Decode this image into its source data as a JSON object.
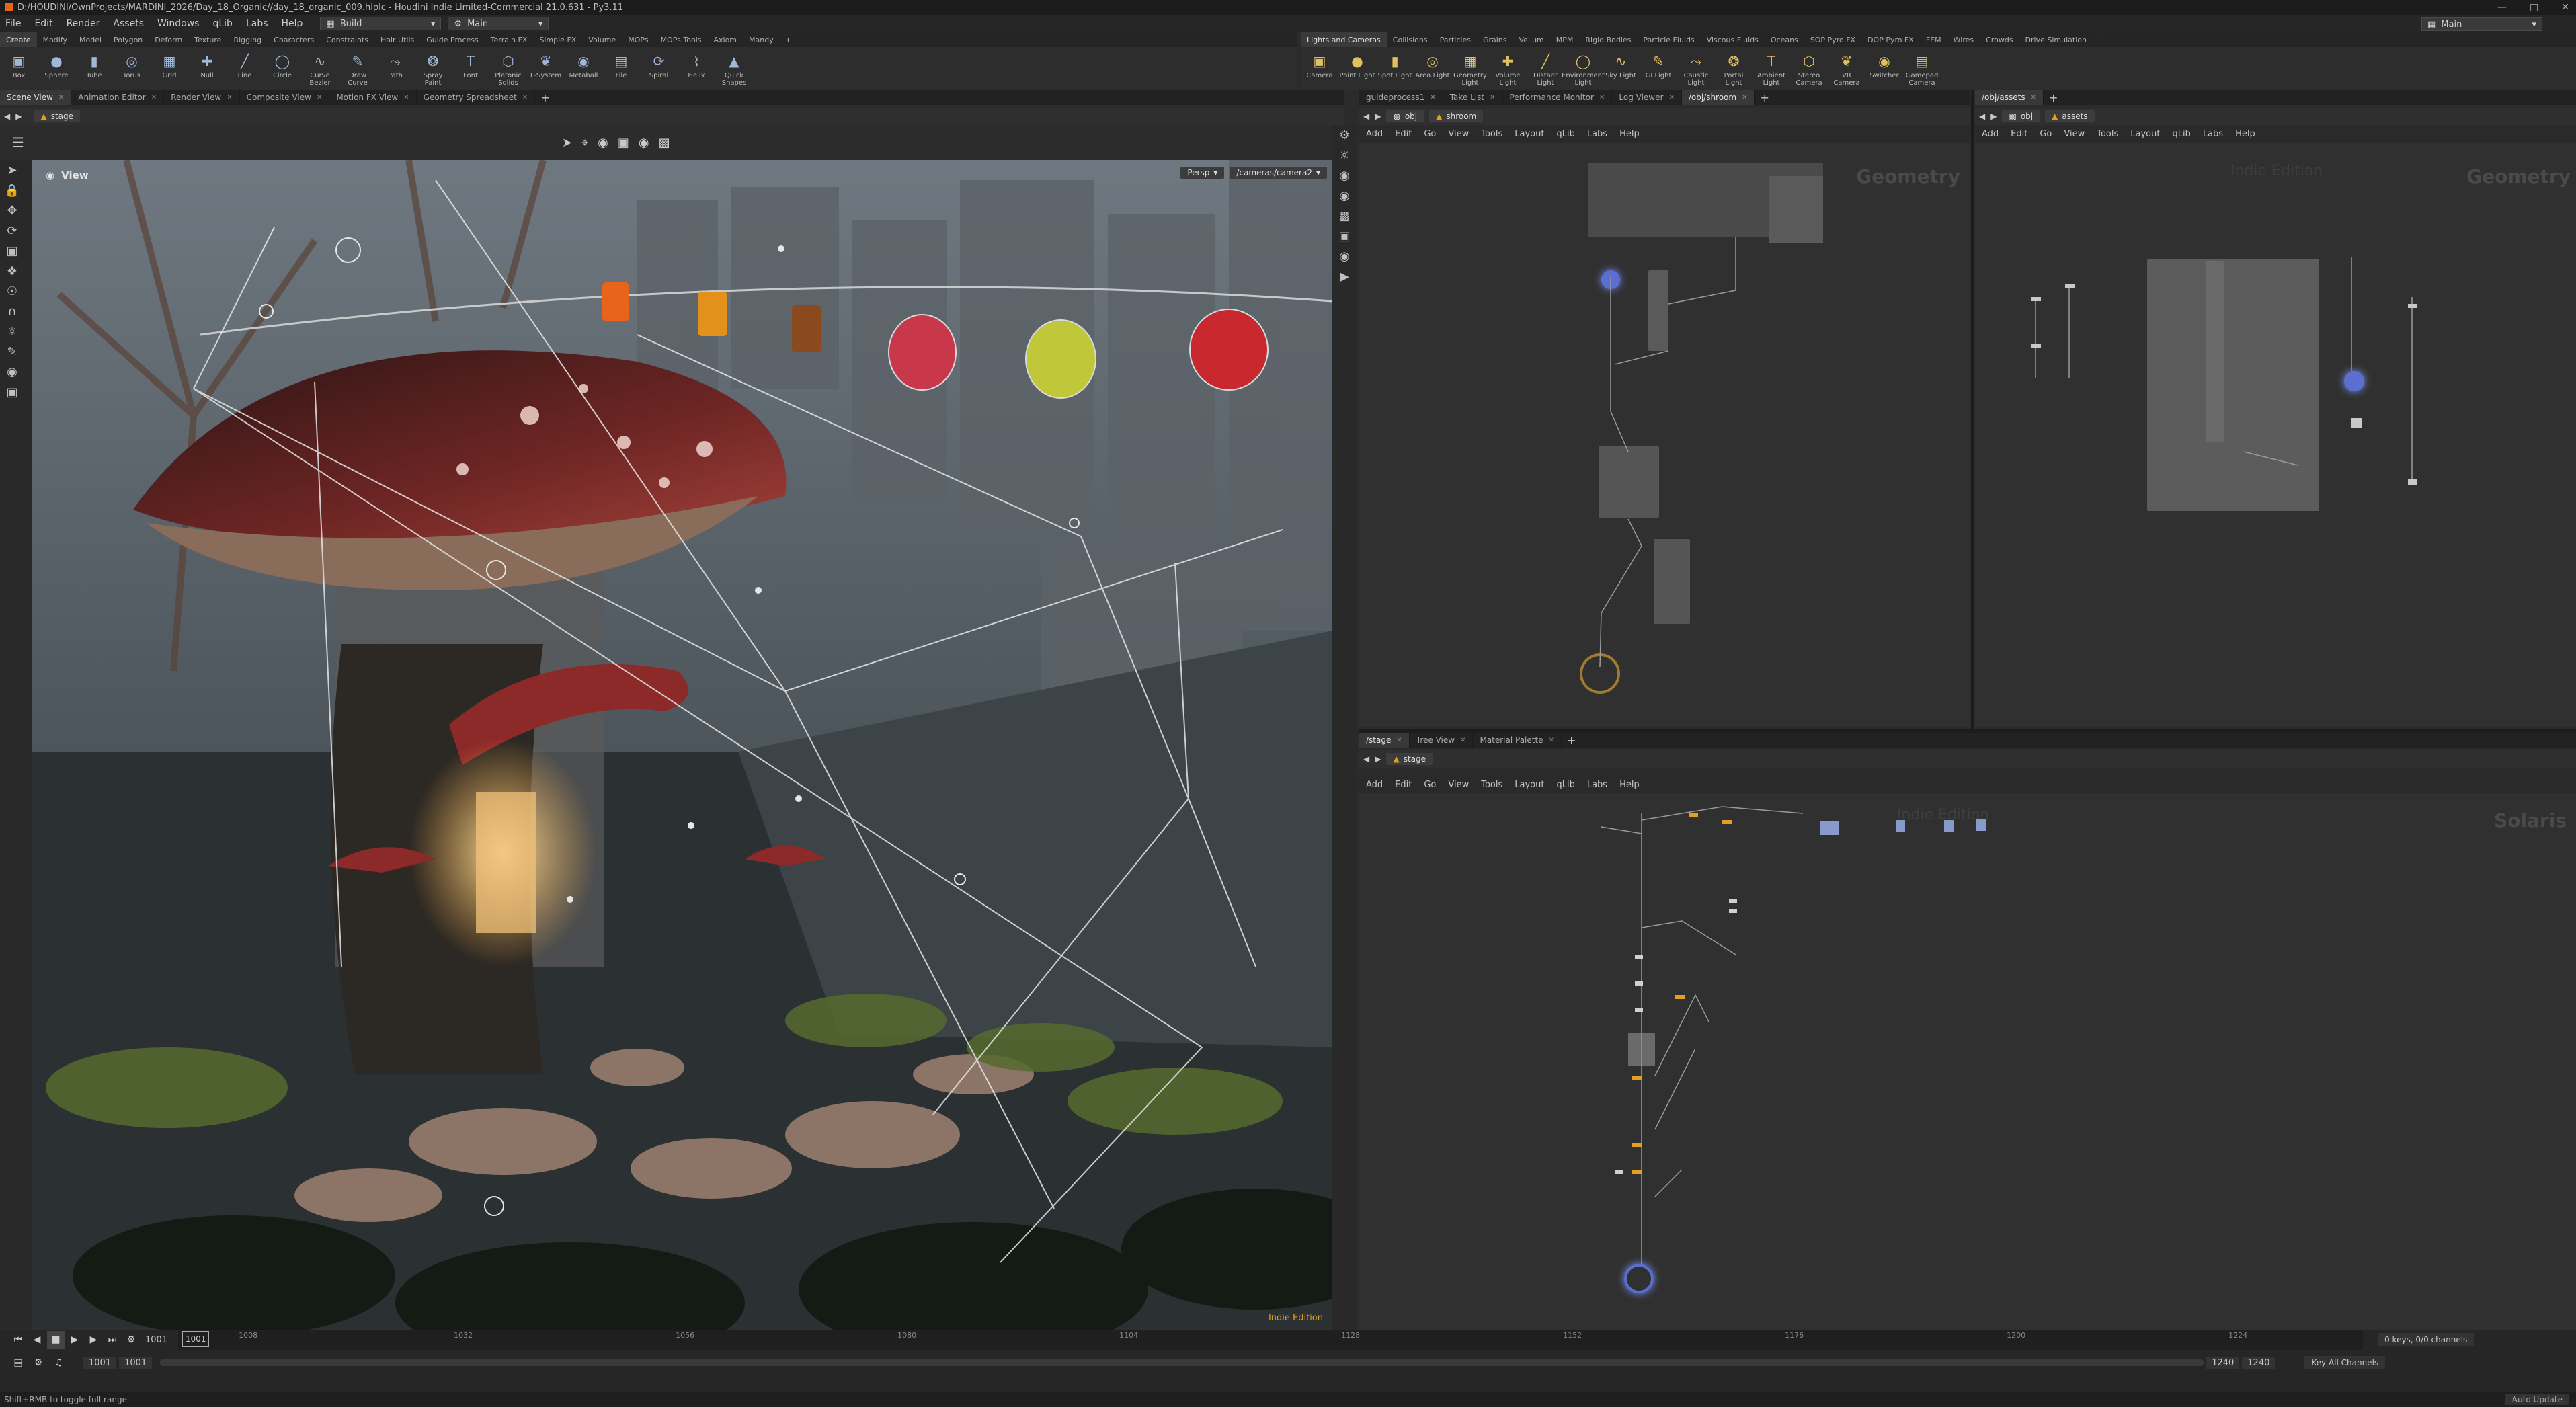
{
  "title": {
    "text": "D:/HOUDINI/OwnProjects/MARDINI_2026/Day_18_Organic//day_18_organic_009.hiplc - Houdini Indie Limited-Commercial 21.0.631 - Py3.11"
  },
  "menubar": {
    "items": [
      "File",
      "Edit",
      "Render",
      "Assets",
      "Windows",
      "qLib",
      "Labs",
      "Help"
    ],
    "desktop": "Build",
    "context": "Main",
    "right_workspace": "Main"
  },
  "shelf_left": {
    "tabs": [
      "Create",
      "Modify",
      "Model",
      "Polygon",
      "Deform",
      "Texture",
      "Rigging",
      "Characters",
      "Constraints",
      "Hair Utils",
      "Guide Process",
      "Terrain FX",
      "Simple FX",
      "Volume",
      "MOPs",
      "MOPs Tools",
      "Axiom",
      "Mandy"
    ],
    "tools": [
      "Box",
      "Sphere",
      "Tube",
      "Torus",
      "Grid",
      "Null",
      "Line",
      "Circle",
      "Curve Bezier",
      "Draw Curve",
      "Path",
      "Spray Paint",
      "Font",
      "Platonic Solids",
      "L-System",
      "Metaball",
      "File",
      "Spiral",
      "Helix",
      "Quick Shapes"
    ]
  },
  "shelf_right": {
    "tabs": [
      "Lights and Cameras",
      "Collisions",
      "Particles",
      "Grains",
      "Vellum",
      "MPM",
      "Rigid Bodies",
      "Particle Fluids",
      "Viscous Fluids",
      "Oceans",
      "SOP Pyro FX",
      "DOP Pyro FX",
      "FEM",
      "Wires",
      "Crowds",
      "Drive Simulation"
    ],
    "tools": [
      "Camera",
      "Point Light",
      "Spot Light",
      "Area Light",
      "Geometry Light",
      "Volume Light",
      "Distant Light",
      "Environment Light",
      "Sky Light",
      "GI Light",
      "Caustic Light",
      "Portal Light",
      "Ambient Light",
      "Stereo Camera",
      "VR Camera",
      "Switcher",
      "Gamepad Camera"
    ]
  },
  "left_panel": {
    "tabs": [
      "Scene View",
      "Animation Editor",
      "Render View",
      "Composite View",
      "Motion FX View",
      "Geometry Spreadsheet"
    ],
    "path": "stage",
    "view_label": "View",
    "persp": "Persp",
    "camera": "/cameras/camera2",
    "edition": "Indie Edition"
  },
  "net_top_left": {
    "tabs": [
      "guideprocess1",
      "Take List",
      "Performance Monitor",
      "Log Viewer",
      "/obj/shroom"
    ],
    "path": [
      "obj",
      "shroom"
    ],
    "menu": [
      "Add",
      "Edit",
      "Go",
      "View",
      "Tools",
      "Layout",
      "qLib",
      "Labs",
      "Help"
    ],
    "context_label": "Geometry"
  },
  "net_top_right": {
    "tabs": [
      "/obj/assets"
    ],
    "path": [
      "obj",
      "assets"
    ],
    "menu": [
      "Add",
      "Edit",
      "Go",
      "View",
      "Tools",
      "Layout",
      "qLib",
      "Labs",
      "Help"
    ],
    "context_label": "Geometry",
    "watermark": "Indie Edition"
  },
  "net_bottom": {
    "tabs": [
      "/stage",
      "Tree View",
      "Material Palette"
    ],
    "path": [
      "stage"
    ],
    "menu": [
      "Add",
      "Edit",
      "Go",
      "View",
      "Tools",
      "Layout",
      "qLib",
      "Labs",
      "Help"
    ],
    "context_label": "Solaris",
    "watermark": "Indie Edition"
  },
  "timeline": {
    "current_frame": "1001",
    "frame_field": "1001",
    "ticks": [
      "1001",
      "1008",
      "1032",
      "1056",
      "1080",
      "1104",
      "1128",
      "1152",
      "1176",
      "1200",
      "1224"
    ],
    "start": "1001",
    "start2": "1001",
    "end": "1240",
    "end2": "1240",
    "keys": "0 keys, 0/0 channels",
    "key_all": "Key All Channels",
    "auto_update": "Auto Update"
  },
  "status": {
    "text": "Shift+RMB to toggle full range"
  },
  "colors": {
    "accent": "#e8641b",
    "node_blue": "#5a6fd0",
    "node_orange": "#e0a020"
  }
}
